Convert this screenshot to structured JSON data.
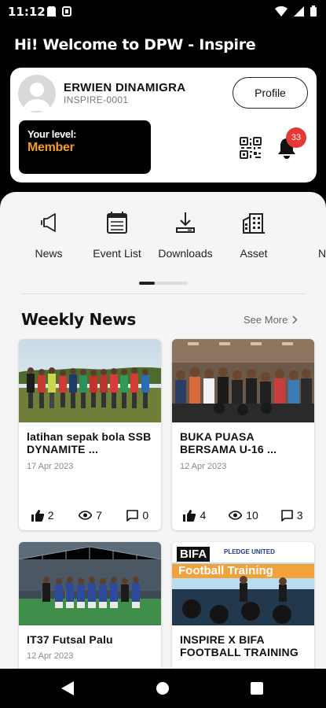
{
  "status": {
    "time": "11:12"
  },
  "welcome": "Hi! Welcome to DPW - Inspire",
  "profile": {
    "name": "ERWIEN DINAMIGRA",
    "id": "INSPIRE-0001",
    "profile_button": "Profile",
    "level_label": "Your level:",
    "level_value": "Member",
    "notification_count": "33"
  },
  "menu": [
    {
      "label": "News",
      "icon": "megaphone-icon"
    },
    {
      "label": "Event List",
      "icon": "calendar-icon"
    },
    {
      "label": "Downloads",
      "icon": "download-icon"
    },
    {
      "label": "Asset",
      "icon": "building-icon"
    },
    {
      "label": "N",
      "icon": ""
    }
  ],
  "section": {
    "title": "Weekly News",
    "see_more": "See More"
  },
  "news": [
    {
      "title": "latihan sepak bola SSB DYNAMITE ...",
      "date": "17 Apr 2023",
      "likes": "2",
      "views": "7",
      "comments": "0"
    },
    {
      "title": "BUKA PUASA BERSAMA U-16 ...",
      "date": "12 Apr 2023",
      "likes": "4",
      "views": "10",
      "comments": "3"
    },
    {
      "title": "IT37 Futsal Palu",
      "date": "12 Apr 2023"
    },
    {
      "title": "INSPIRE X BIFA FOOTBALL TRAINING",
      "banner_brand": "BIFA",
      "banner_sub": "PLEDGE UNITED",
      "banner_text": "Football Training"
    }
  ],
  "colors": {
    "accent": "#f29d27",
    "badge": "#e53935"
  }
}
